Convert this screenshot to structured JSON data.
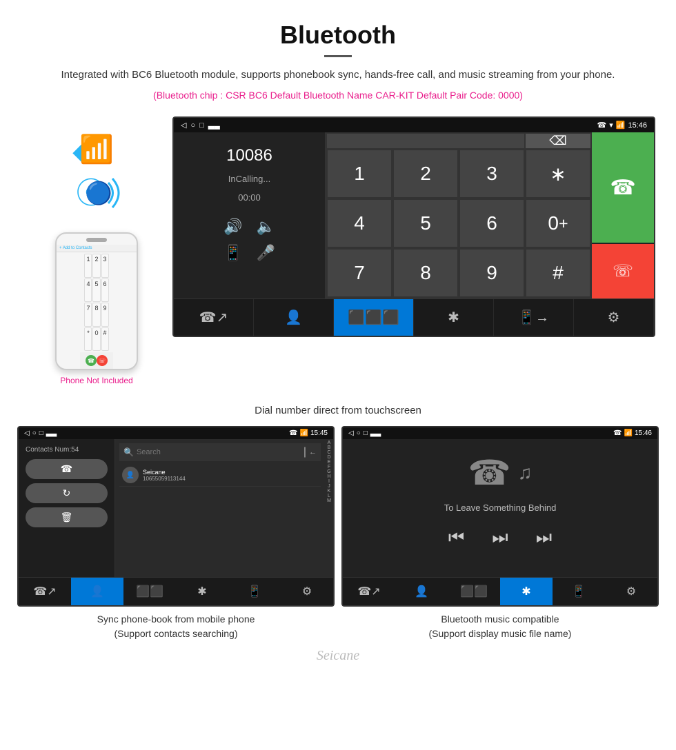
{
  "header": {
    "title": "Bluetooth",
    "description": "Integrated with BC6 Bluetooth module, supports phonebook sync, hands-free call, and music streaming from your phone.",
    "specs": "(Bluetooth chip : CSR BC6    Default Bluetooth Name CAR-KIT    Default Pair Code: 0000)"
  },
  "phone_left": {
    "not_included": "Phone Not Included",
    "keys": [
      "1",
      "2",
      "3",
      "4",
      "5",
      "6",
      "7",
      "8",
      "9",
      "*",
      "0",
      "#"
    ]
  },
  "big_screen": {
    "status_bar": {
      "time": "15:46",
      "left_icons": [
        "◁",
        "○",
        "□"
      ]
    },
    "dial": {
      "number": "10086",
      "status": "InCalling...",
      "timer": "00:00",
      "keys": [
        "1",
        "2",
        "3",
        "*",
        "4",
        "5",
        "6",
        "0+",
        "7",
        "8",
        "9",
        "#"
      ]
    },
    "toolbar": {
      "items": [
        "📞↗",
        "👤",
        "⠿",
        "✱",
        "📱→",
        "⚙"
      ]
    }
  },
  "caption_big": "Dial number direct from touchscreen",
  "contacts_screen": {
    "status_bar": {
      "time": "15:45"
    },
    "contacts_num": "Contacts Num:54",
    "search_placeholder": "Search",
    "contact": {
      "name": "Seicane",
      "phone": "10655059113144"
    },
    "alpha": [
      "A",
      "B",
      "C",
      "D",
      "E",
      "F",
      "G",
      "H",
      "I",
      "J",
      "K",
      "L",
      "M"
    ]
  },
  "caption_contacts": {
    "line1": "Sync phone-book from mobile phone",
    "line2": "(Support contacts searching)"
  },
  "music_screen": {
    "status_bar": {
      "time": "15:46"
    },
    "song_title": "To Leave Something Behind"
  },
  "caption_music": {
    "line1": "Bluetooth music compatible",
    "line2": "(Support display music file name)"
  },
  "watermark": "Seicane"
}
